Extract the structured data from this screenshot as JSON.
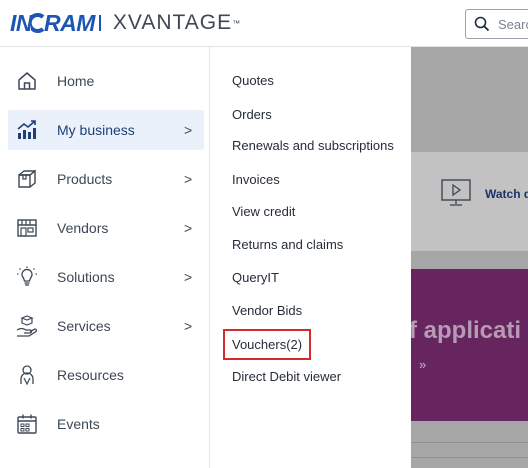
{
  "header": {
    "logo_ingram": "IN",
    "logo_ingram_b": "RAM",
    "logo_xvantage": "XVANTAGE",
    "logo_tm": "™",
    "search_placeholder": "Searc"
  },
  "leftnav": {
    "items": [
      {
        "label": "Home",
        "icon": "home-icon",
        "has_chevron": false
      },
      {
        "label": "My business",
        "icon": "chart-icon",
        "has_chevron": true,
        "active": true
      },
      {
        "label": "Products",
        "icon": "box-icon",
        "has_chevron": true
      },
      {
        "label": "Vendors",
        "icon": "storefront-icon",
        "has_chevron": true
      },
      {
        "label": "Solutions",
        "icon": "lightbulb-icon",
        "has_chevron": true
      },
      {
        "label": "Services",
        "icon": "hand-service-icon",
        "has_chevron": true
      },
      {
        "label": "Resources",
        "icon": "people-icon",
        "has_chevron": false
      },
      {
        "label": "Events",
        "icon": "calendar-icon",
        "has_chevron": false
      }
    ],
    "chevron": ">"
  },
  "submenu": {
    "items": [
      "Quotes",
      "Orders",
      "Renewals and subscriptions",
      "Invoices",
      "View credit",
      "Returns and claims",
      "QueryIT",
      "Vendor Bids",
      "Vouchers(2)",
      "Direct Debit viewer"
    ]
  },
  "background": {
    "watch_text": "Watch d",
    "banner_text": "f applicati",
    "banner_link": "»"
  },
  "colors": {
    "brand_blue": "#1d55b4",
    "highlight_red": "#d42c2c",
    "active_bg": "#eaf1fb",
    "banner_purple": "#67255f"
  }
}
